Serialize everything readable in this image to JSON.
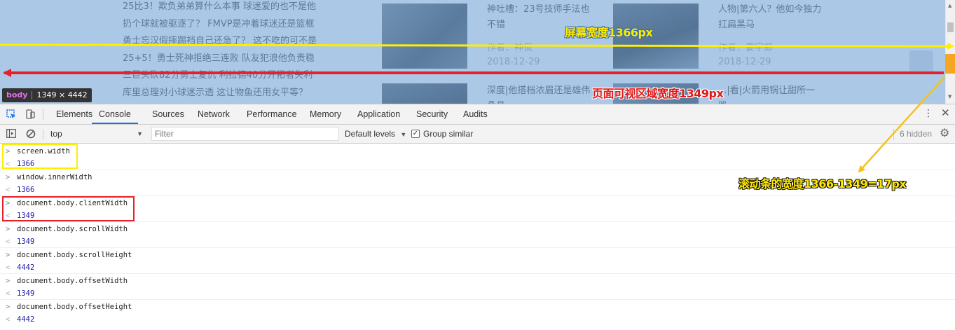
{
  "page": {
    "news_lines": [
      "25比3！欺负弟弟算什么本事 球迷爱的也不是他",
      "扔个球就被驱逐了？ FMVP是冲着球迷还是篮框",
      "勇士忘汉假摔踢裆自己还急了？ 这不吃的可不是",
      "25+5！勇士死神拒绝三连败 队友犯浪他负责稳",
      "三巨头砍82分勇士复仇 利拉德40分开拓者失利",
      "库里总理对小球迷示透 这让物鱼还用女平等？"
    ],
    "cards": [
      {
        "title": "神吐槽：23号技师手法也不错",
        "author": "作者：神侃",
        "date": "2018-12-29"
      },
      {
        "title": "人物|第六人？他如今独力扛扁黑马",
        "author": "作者：要宇郎",
        "date": "2018-12-29"
      },
      {
        "title": "深度|他搭档浓眉还是雄伟桑具",
        "author": "",
        "date": ""
      },
      {
        "title": "...|看|火箭用锅让甜所一路",
        "author": "",
        "date": ""
      }
    ]
  },
  "body_badge": {
    "tag": "body",
    "size": "1349 × 4442"
  },
  "devtools": {
    "tabs": [
      "Elements",
      "Console",
      "Sources",
      "Network",
      "Performance",
      "Memory",
      "Application",
      "Security",
      "Audits"
    ],
    "active_tab": "Console",
    "context": "top",
    "filter_placeholder": "Filter",
    "levels": "Default levels",
    "group_similar": "Group similar",
    "hidden": "6 hidden"
  },
  "console": [
    {
      "cmd": "screen.width",
      "res": "1366"
    },
    {
      "cmd": "window.innerWidth",
      "res": "1366"
    },
    {
      "cmd": "document.body.clientWidth",
      "res": "1349"
    },
    {
      "cmd": "document.body.scrollWidth",
      "res": "1349"
    },
    {
      "cmd": "document.body.scrollHeight",
      "res": "4442"
    },
    {
      "cmd": "document.body.offsetWidth",
      "res": "1349"
    },
    {
      "cmd": "document.body.offsetHeight",
      "res": "4442"
    }
  ],
  "annotations": {
    "screen": "屏幕宽度1366px",
    "viewport": "页面可视区域宽度1349px",
    "scrollbar": "滚动条的宽度1366-1349=17px"
  },
  "colors": {
    "yellow": "#ffee00",
    "red": "#e8202a",
    "orange_arrow": "#f5c21b",
    "annot_yellow_text": "#ffe900",
    "annot_red_text": "#e01818",
    "devtools_accent": "#1a73e8"
  }
}
